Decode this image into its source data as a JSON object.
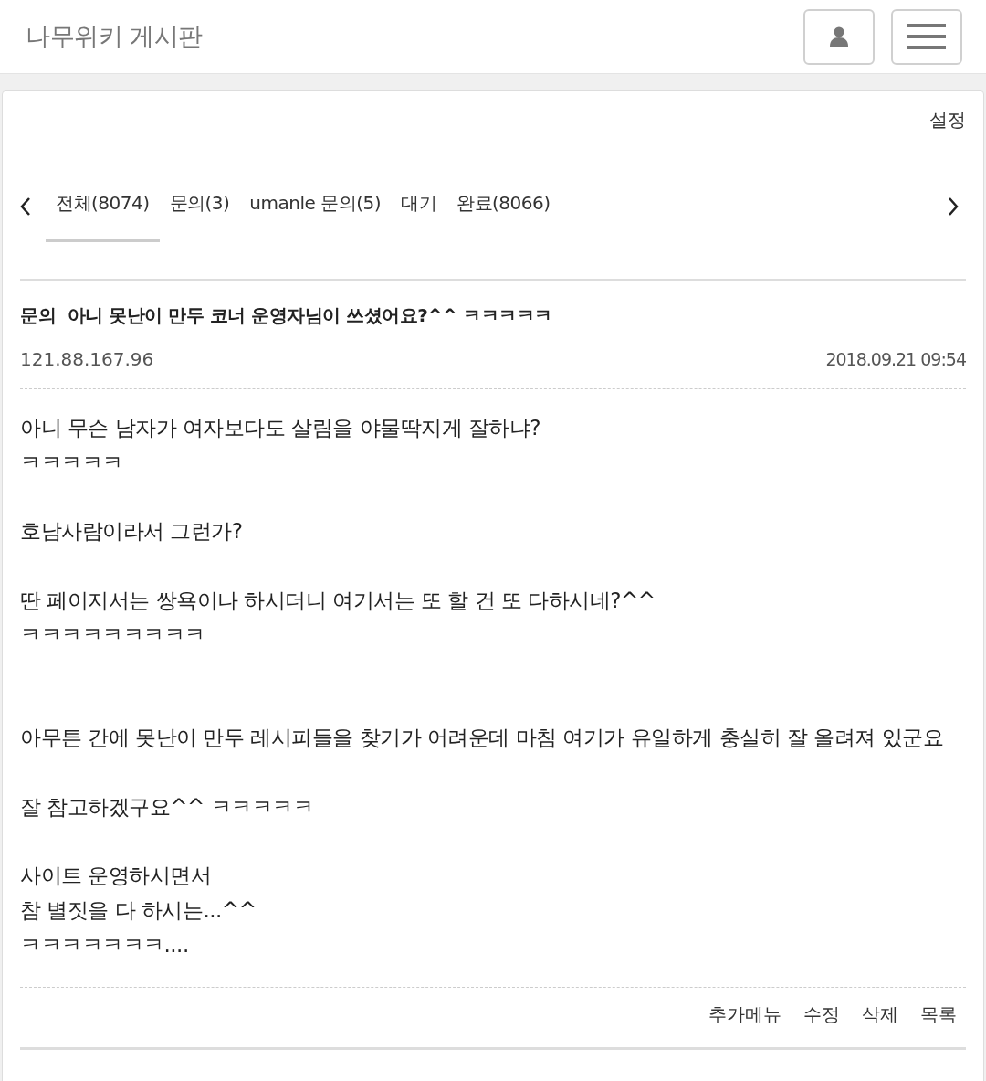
{
  "header": {
    "title": "나무위키 게시판"
  },
  "settings_link": "설정",
  "tabs": [
    {
      "label": "전체(8074)",
      "selected": true
    },
    {
      "label": "문의(3)",
      "selected": false
    },
    {
      "label": "umanle 문의(5)",
      "selected": false
    },
    {
      "label": "대기",
      "selected": false
    },
    {
      "label": "완료(8066)",
      "selected": false
    }
  ],
  "post": {
    "category": "문의",
    "title": "아니 못난이 만두 코너 운영자님이 쓰셨어요?^^ ㅋㅋㅋㅋㅋ",
    "author": "121.88.167.96",
    "date": "2018.09.21 09:54",
    "body": "아니 무슨 남자가 여자보다도 살림을 야물딱지게 잘하냐?\nㅋㅋㅋㅋㅋ\n\n호남사람이라서 그런가?\n\n딴 페이지서는 쌍욕이나 하시더니 여기서는 또 할 건 또 다하시네?^^\nㅋㅋㅋㅋㅋㅋㅋㅋㅋ\n\n\n아무튼 간에 못난이 만두 레시피들을 찾기가 어려운데 마침 여기가 유일하게 충실히 잘 올려져 있군요\n\n잘 참고하겠구요^^ ㅋㅋㅋㅋㅋ\n\n사이트 운영하시면서\n참 별짓을 다 하시는...^^\nㅋㅋㅋㅋㅋㅋㅋ...."
  },
  "actions": [
    "추가메뉴",
    "수정",
    "삭제",
    "목록"
  ]
}
